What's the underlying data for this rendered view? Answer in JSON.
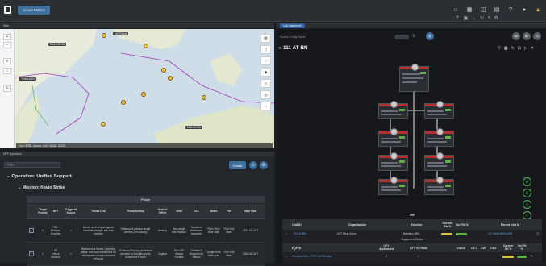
{
  "topbar": {
    "create_button": "Create Entities",
    "icons": [
      "home-icon",
      "grid-icon",
      "map-icon",
      "chart-icon",
      "help-icon",
      "user-icon",
      "warning-icon"
    ],
    "sub_icons": [
      "plus-icon",
      "layout-icon",
      "chevron-down-icon",
      "refresh-icon",
      "save-icon",
      "settings-icon"
    ]
  },
  "map_panel": {
    "tab_label": "Map",
    "labels": [
      "CAMBODIA",
      "THAILAND",
      "VIETNAM",
      "MALAYSIA"
    ],
    "coords": "Esri, HERE, Garmin, FAO, NOAA, USGS"
  },
  "tasks_panel": {
    "tab_label": "HPT Synchron",
    "filter_placeholder": "Filter",
    "create_label": "Create",
    "operation_title": "Operation: Unified Support",
    "mission_title": "Mission: Kavio Strike",
    "phase_label": "Phase",
    "columns": [
      "",
      "Target Priority",
      "HPT",
      "Triggered Source",
      "Threat COA",
      "Threat Activity",
      "Desired Effect",
      "ADM",
      "TSS",
      "Notes",
      "Title",
      "Start Time"
    ],
    "rows": [
      {
        "priority": "4",
        "hpt": "PRC - Defense Complex",
        "source": "",
        "coa": "Barrier and bring alongside moments multiple and auto vehicles",
        "activity": "Restaurant primary ample deniers, pre-loading",
        "effect": "Destroy",
        "adm": "Neo Anglit Mini Ranson",
        "tss": "Treatment Whitemore Assembly",
        "notes": "Piper Grey Blue Main",
        "title": "Fuel Hub Main",
        "start": "2024-08-01 T"
      },
      {
        "priority": "1",
        "hpt": "HT Hence Stanford",
        "source": "",
        "coa": "Bidirectional Nodes, Imposing patron and Ship maneuvers for deployment of main advance of troops",
        "activity": "Advanced Survey, predefined research in Southern ports, Scheme of Forces",
        "effect": "Capture",
        "adm": "Neo OPI Stanus Pacifica",
        "tss": "Treatment Blueprint Alt Station",
        "notes": "Jungle Hold Main Area",
        "title": "Fuel Hub Main",
        "start": "2024-08-01 T"
      }
    ]
  },
  "right_panel": {
    "tab_label": "Unit Statement",
    "search_placeholder": "Search Entity Name",
    "unit_title": "111 AT BN",
    "header_icons": [
      "filter-icon",
      "grid-icon",
      "refresh-icon",
      "lock-icon",
      "send-icon",
      "close-icon"
    ],
    "corner_badges": [
      "AA",
      "Bn",
      "Co"
    ],
    "unit_table": {
      "columns": [
        "Unit ID",
        "Organization",
        "Echelon",
        "Current Str %",
        "Vol Fill %",
        "Parent Unit Id"
      ],
      "row": {
        "unit_id": "111-AT-BN",
        "organization": "ATT-Fleet Armor",
        "echelon": "Battalion (BN)",
        "parent": "CO-1843-0009-1000"
      },
      "equipment_title": "Equipment Status",
      "eq_columns": [
        "EQP ID",
        "QTY Authorized",
        "QTY On Hand",
        "OMSD",
        "OCT",
        "CAT",
        "OSG",
        "Current Str %",
        "Vol Fill %"
      ],
      "eq_row": {
        "eqp": "FM-ADV-0001-TOPP-ALPAR-Mny",
        "qty_auth": "2",
        "qty_hand": "2"
      }
    }
  },
  "colors": {
    "accent": "#3f6f9c",
    "status_ok": "#5fb046",
    "status_bad": "#b3312c",
    "warning": "#e3b02b",
    "tab_active": "#2e5f9c"
  }
}
